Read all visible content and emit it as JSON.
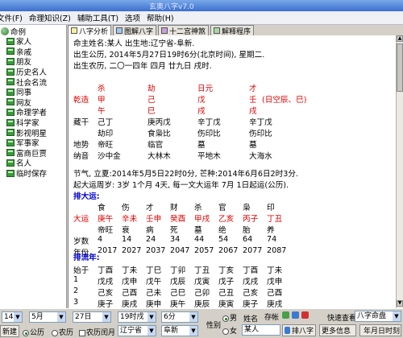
{
  "window": {
    "title": "玄奥八字v7.0"
  },
  "menu": [
    "文件(F)",
    "命理知识(Z)",
    "辅助工具(T)",
    "选项",
    "帮助(H)"
  ],
  "sidebar": {
    "root": "命例",
    "items": [
      "家人",
      "亲戚",
      "朋友",
      "历史名人",
      "社会名流",
      "同事",
      "网友",
      "命理学者",
      "科学家",
      "影视明星",
      "军事家",
      "富商巨贾",
      "名人",
      "临时保存"
    ]
  },
  "tabs": [
    "八字分析",
    "图解八字",
    "十二宫神煞",
    "解释程序"
  ],
  "chart": {
    "header": "命主姓名:某人   出生地:辽宁省-阜新.",
    "solar": "出生公历, 2014年5月27日19时6分(北京时间), 星期二.",
    "lunar": "出生农历, 二〇一四年 四月 廿九日 戌时.",
    "shishen": [
      "杀",
      "劫",
      "日元",
      "才"
    ],
    "qiankun": {
      "label": "乾造",
      "stems": [
        "甲",
        "己",
        "戊",
        "壬"
      ],
      "note": "(日空辰、巳)"
    },
    "branches": [
      "午",
      "巳",
      "戌",
      "戌"
    ],
    "canggan": {
      "label": "藏干",
      "values": [
        "己丁",
        "庚丙戊",
        "辛丁戊",
        "辛丁戊"
      ]
    },
    "canggan2": [
      "劫印",
      "食枭比",
      "伤印比",
      "伤印比"
    ],
    "dishi": {
      "label": "地势",
      "values": [
        "帝旺",
        "临官",
        "墓",
        "墓"
      ]
    },
    "nayin": {
      "label": "纳音",
      "values": [
        "沙中金",
        "大林木",
        "平地木",
        "大海水"
      ]
    },
    "jieqi": "节气, 立夏:2014年5月5日22时0分, 芒种:2014年6月6日2时3分.",
    "qiyun": "起大运周岁: 3岁 1个月 4天, 每一文大运年 7月 1日起运(公历).",
    "dayun_title": "排大运:",
    "dayun_shishen": [
      "食",
      "伤",
      "才",
      "财",
      "杀",
      "官",
      "枭",
      "印"
    ],
    "dayun": {
      "label": "大运",
      "values": [
        "庚午",
        "辛未",
        "壬申",
        "癸酉",
        "甲戌",
        "乙亥",
        "丙子",
        "丁丑"
      ]
    },
    "dayun_state": [
      "帝旺",
      "衰",
      "病",
      "死",
      "墓",
      "绝",
      "胎",
      "养"
    ],
    "age": {
      "label": "岁数",
      "values": [
        "4",
        "14",
        "24",
        "34",
        "44",
        "54",
        "64",
        "74"
      ]
    },
    "year": {
      "label": "年份",
      "values": [
        "2017",
        "2027",
        "2037",
        "2047",
        "2057",
        "2067",
        "2077",
        "2087"
      ]
    },
    "liunian_title": "排流年:",
    "liunian": {
      "start_label": "始于",
      "start": [
        "丁酉",
        "丁未",
        "丁巳",
        "丁卯",
        "丁丑",
        "丁亥",
        "丁酉",
        "丁未"
      ],
      "rows": [
        {
          "label": "1",
          "values": [
            "戊戌",
            "戊申",
            "戊午",
            "戊辰",
            "戊寅",
            "戊子",
            "戊戌",
            "戊申"
          ]
        },
        {
          "label": "2",
          "values": [
            "己亥",
            "己酉",
            "己未",
            "己巳",
            "己卯",
            "己丑",
            "己亥",
            "己酉"
          ]
        },
        {
          "label": "3",
          "values": [
            "庚子",
            "庚戌",
            "庚申",
            "庚午",
            "庚辰",
            "庚寅",
            "庚子",
            "庚戌"
          ]
        }
      ]
    }
  },
  "bottom": {
    "year": "14",
    "month": "5月",
    "day": "27日",
    "hour": "19时戌",
    "minute": "6分",
    "gender_label": "性别",
    "gender_male": "男",
    "gender_female": "女",
    "name_label": "姓名",
    "name_value": "某人",
    "save_label": "存帐",
    "quick_view_label": "快速查看",
    "quick_view_value": "八字命盘",
    "new_btn": "新建",
    "solar_radio": "公历",
    "lunar_radio": "农历",
    "leap_check": "农历闰月",
    "province": "辽宁省",
    "city": "阜新",
    "paiba_btn": "排八字",
    "more_btn": "更多信息",
    "lunar_cal_btn": "年月日时刻",
    "accent": "#e00000",
    "heading_color": "#0000cc"
  }
}
